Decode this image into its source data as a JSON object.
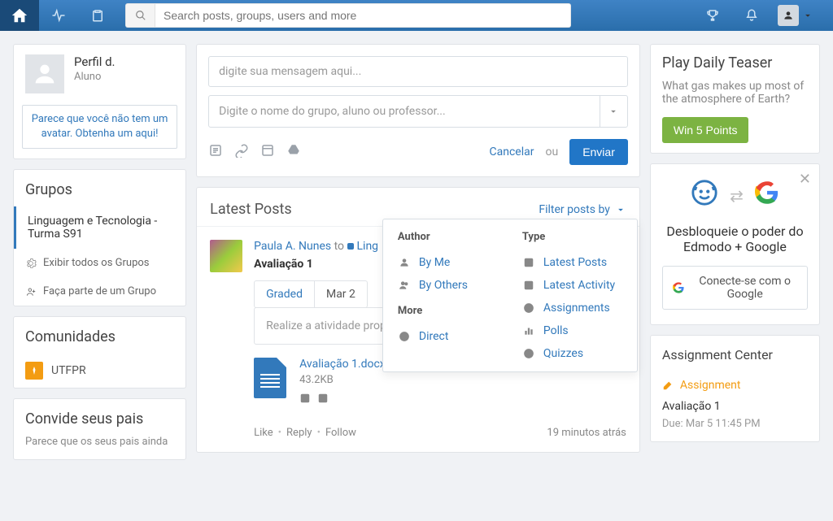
{
  "topnav": {
    "search_placeholder": "Search posts, groups, users and more"
  },
  "profile": {
    "name": "Perfil d.",
    "role": "Aluno",
    "avatar_prompt": "Parece que você não tem um avatar. Obtenha um aqui!"
  },
  "groups": {
    "heading": "Grupos",
    "active_group": "Linguagem e Tecnologia - Turma S91",
    "show_all": "Exibir todos os Grupos",
    "join": "Faça parte de um Grupo"
  },
  "communities": {
    "heading": "Comunidades",
    "item1": "UTFPR"
  },
  "invite": {
    "heading": "Convide seus pais",
    "text": "Parece que os seus pais ainda"
  },
  "composer": {
    "message_placeholder": "digite sua mensagem aqui...",
    "recipient_placeholder": "Digite o nome do grupo, aluno ou professor...",
    "cancel": "Cancelar",
    "or": "ou",
    "send": "Enviar"
  },
  "posts": {
    "header": "Latest Posts",
    "filter_label": "Filter posts by"
  },
  "filter_dd": {
    "author": "Author",
    "by_me": "By Me",
    "by_others": "By Others",
    "more": "More",
    "direct": "Direct",
    "type": "Type",
    "latest_posts": "Latest Posts",
    "latest_activity": "Latest Activity",
    "assignments": "Assignments",
    "polls": "Polls",
    "quizzes": "Quizzes"
  },
  "post1": {
    "author": "Paula A. Nunes",
    "to": "to",
    "group": "Ling",
    "title": "Avaliação 1",
    "graded": "Graded",
    "due": "Mar 2",
    "activity_text": "Realize a atividade prop",
    "file_name": "Avaliação 1.docx",
    "file_size": "43.2KB",
    "like": "Like",
    "reply": "Reply",
    "follow": "Follow",
    "time": "19 minutos atrás"
  },
  "teaser": {
    "heading": "Play Daily Teaser",
    "question": "What gas makes up most of the atmosphere of Earth?",
    "button": "Win 5 Points"
  },
  "gpromo": {
    "text": "Desbloqueie o poder do Edmodo + Google",
    "button": "Conecte-se com o Google"
  },
  "assign": {
    "heading": "Assignment Center",
    "link": "Assignment",
    "title": "Avaliação 1",
    "due": "Due: Mar 5 11:45 PM"
  }
}
